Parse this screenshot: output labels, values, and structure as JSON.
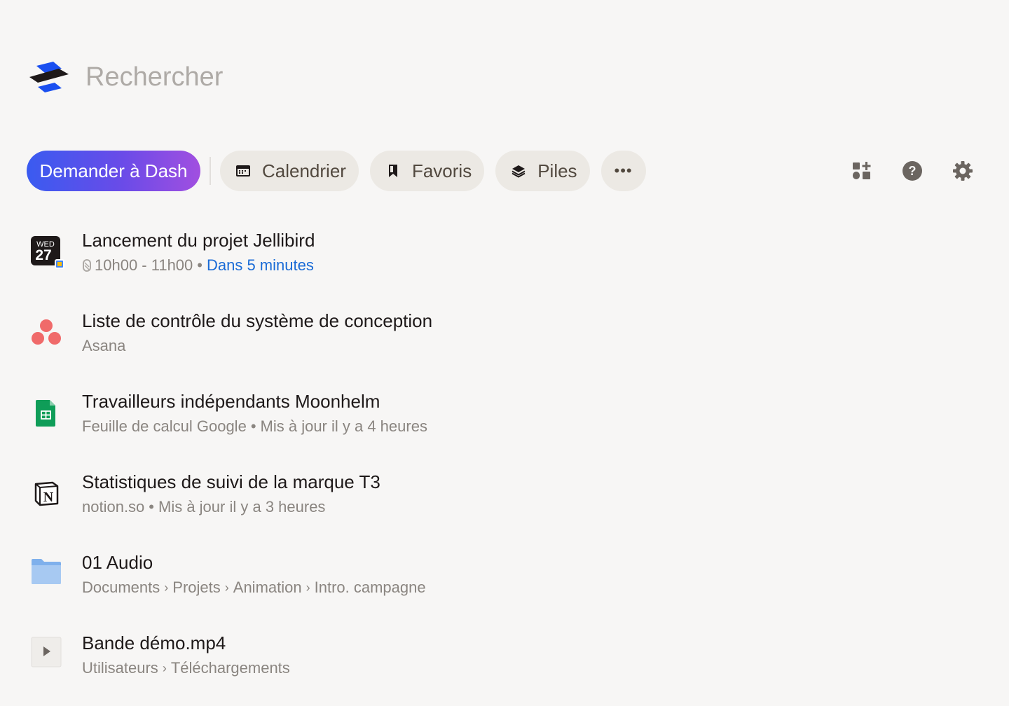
{
  "search": {
    "placeholder": "Rechercher"
  },
  "toolbar": {
    "ask_label": "Demander à Dash",
    "calendar_label": "Calendrier",
    "favorites_label": "Favoris",
    "stacks_label": "Piles",
    "more_label": "•••"
  },
  "right_tools": {
    "add_widget_icon": "add-widget-icon",
    "help_icon": "help-icon",
    "settings_icon": "gear-icon"
  },
  "colors": {
    "accent_gradient_start": "#3a5bf0",
    "accent_gradient_end": "#a14fe0",
    "link_blue": "#1a6bd6",
    "pill_bg": "#ece9e4",
    "page_bg": "#f7f6f5"
  },
  "calendar_badge": {
    "day": "WED",
    "date": "27"
  },
  "results": [
    {
      "icon": "calendar-event-icon",
      "title": "Lancement du projet Jellibird",
      "time": "10h00 - 11h00",
      "separator": "•",
      "relative": "Dans 5 minutes"
    },
    {
      "icon": "asana-icon",
      "title": "Liste de contrôle du système de conception",
      "source": "Asana"
    },
    {
      "icon": "google-sheets-icon",
      "title": "Travailleurs indépendants Moonhelm",
      "source": "Feuille de calcul Google",
      "separator": "•",
      "updated": "Mis à jour il y a 4 heures"
    },
    {
      "icon": "notion-icon",
      "title": "Statistiques de suivi de la marque T3",
      "source": "notion.so",
      "separator": "•",
      "updated": "Mis à jour il y a 3 heures"
    },
    {
      "icon": "folder-icon",
      "title": "01 Audio",
      "path": [
        "Documents",
        "Projets",
        "Animation",
        "Intro. campagne"
      ],
      "path_separator": "›"
    },
    {
      "icon": "video-file-icon",
      "title": "Bande démo.mp4",
      "path": [
        "Utilisateurs",
        "Téléchargements"
      ],
      "path_separator": "›"
    }
  ]
}
